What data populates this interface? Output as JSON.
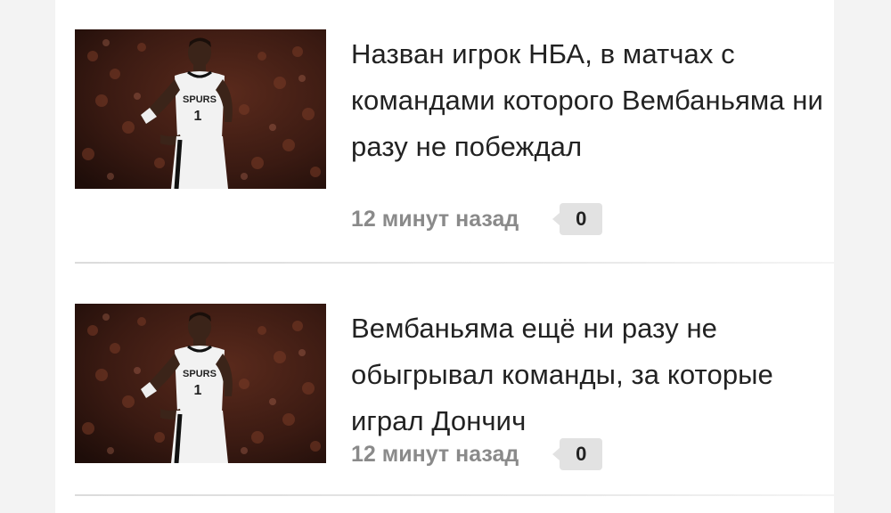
{
  "articles": [
    {
      "image": "basketball-player-photo",
      "jersey_text": "SPURS",
      "jersey_number": "1",
      "title": "Назван игрок НБА, в матчах с командами которого Вембаньяма ни разу не побеждал",
      "time": "12 минут назад",
      "comments": "0"
    },
    {
      "image": "basketball-player-photo",
      "jersey_text": "SPURS",
      "jersey_number": "1",
      "title": "Вембаньяма ещё ни разу не обыгрывал команды, за которые играл Дончич",
      "time": "12 минут назад",
      "comments": "0"
    }
  ],
  "colors": {
    "background": "#f3f3f3",
    "card": "#ffffff",
    "headline": "#222222",
    "meta": "#8a8a8a",
    "badge": "#e2e2e2"
  }
}
